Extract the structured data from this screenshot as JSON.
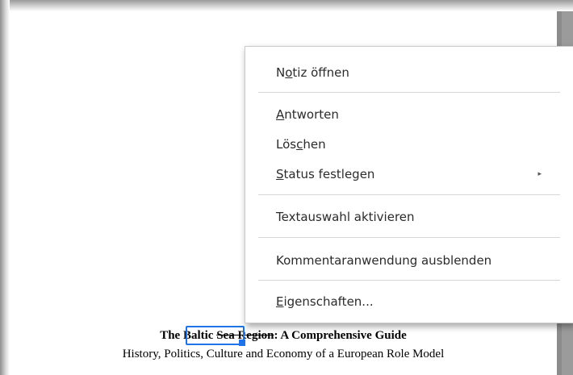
{
  "document": {
    "title_prefix": "The Baltic ",
    "title_highlight": "Sea Region",
    "title_suffix": ": A Comprehensive Guide",
    "subtitle": "History, Politics, Culture and Economy of a European Role Model"
  },
  "context_menu": {
    "items": [
      {
        "pre": "N",
        "acc": "o",
        "post": "tiz öffnen"
      },
      {
        "pre": "",
        "acc": "A",
        "post": "ntworten"
      },
      {
        "pre": "Lös",
        "acc": "c",
        "post": "hen"
      },
      {
        "pre": "",
        "acc": "S",
        "post": "tatus festlegen",
        "submenu_icon": "▸"
      },
      {
        "pre": "Textauswahl aktivieren",
        "acc": "",
        "post": ""
      },
      {
        "pre": "Kommentaranwendung ausblenden",
        "acc": "",
        "post": ""
      },
      {
        "pre": "",
        "acc": "E",
        "post": "igenschaften..."
      }
    ]
  },
  "colors": {
    "selection_border": "#1e73e8",
    "scrollbar": "#8c8c8c"
  },
  "icons": {
    "submenu": "chevron-right-icon"
  }
}
